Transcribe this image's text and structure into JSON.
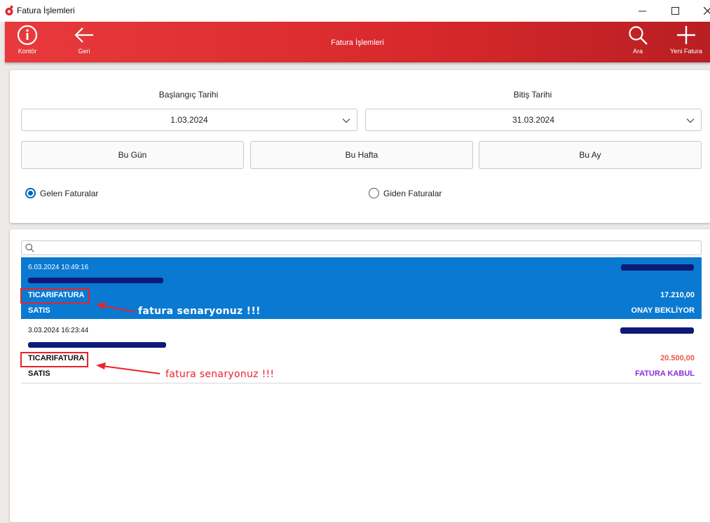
{
  "window": {
    "title": "Fatura İşlemleri"
  },
  "appbar": {
    "title": "Fatura İşlemleri",
    "kontor_label": "Kontör",
    "geri_label": "Geri",
    "ara_label": "Ara",
    "yeni_label": "Yeni Fatura"
  },
  "filters": {
    "start_label": "Başlangıç Tarihi",
    "start_value": "1.03.2024",
    "end_label": "Bitiş Tarihi",
    "end_value": "31.03.2024",
    "quick": [
      "Bu Gün",
      "Bu Hafta",
      "Bu Ay"
    ],
    "radio_incoming": "Gelen Faturalar",
    "radio_outgoing": "Giden Faturalar",
    "selected": "Gelen Faturalar"
  },
  "search": {
    "placeholder": "",
    "value": ""
  },
  "invoices": [
    {
      "date": "6.03.2024 10:49:16",
      "scenario": "TICARIFATURA",
      "type": "SATIS",
      "amount": "17.210,00",
      "status": "ONAY BEKLİYOR",
      "selected": true
    },
    {
      "date": "3.03.2024 16:23:44",
      "scenario": "TICARIFATURA",
      "type": "SATIS",
      "amount": "20.500,00",
      "status": "FATURA KABUL",
      "selected": false
    }
  ],
  "annotations": [
    "fatura senaryonuz !!!",
    "fatura senaryonuz !!!"
  ],
  "colors": {
    "appbar": "#d7282c",
    "selected_row": "#0a79d1",
    "redaction": "#0d1a78",
    "annotation": "#e8232a",
    "amount_highlight": "#e8584c",
    "status_accepted": "#8a2be2",
    "radio_accent": "#0067c0"
  },
  "icons": [
    "app-icon",
    "info-icon",
    "back-arrow-icon",
    "search-icon",
    "plus-icon",
    "minimize-icon",
    "maximize-icon",
    "close-icon",
    "chevron-down-icon"
  ]
}
